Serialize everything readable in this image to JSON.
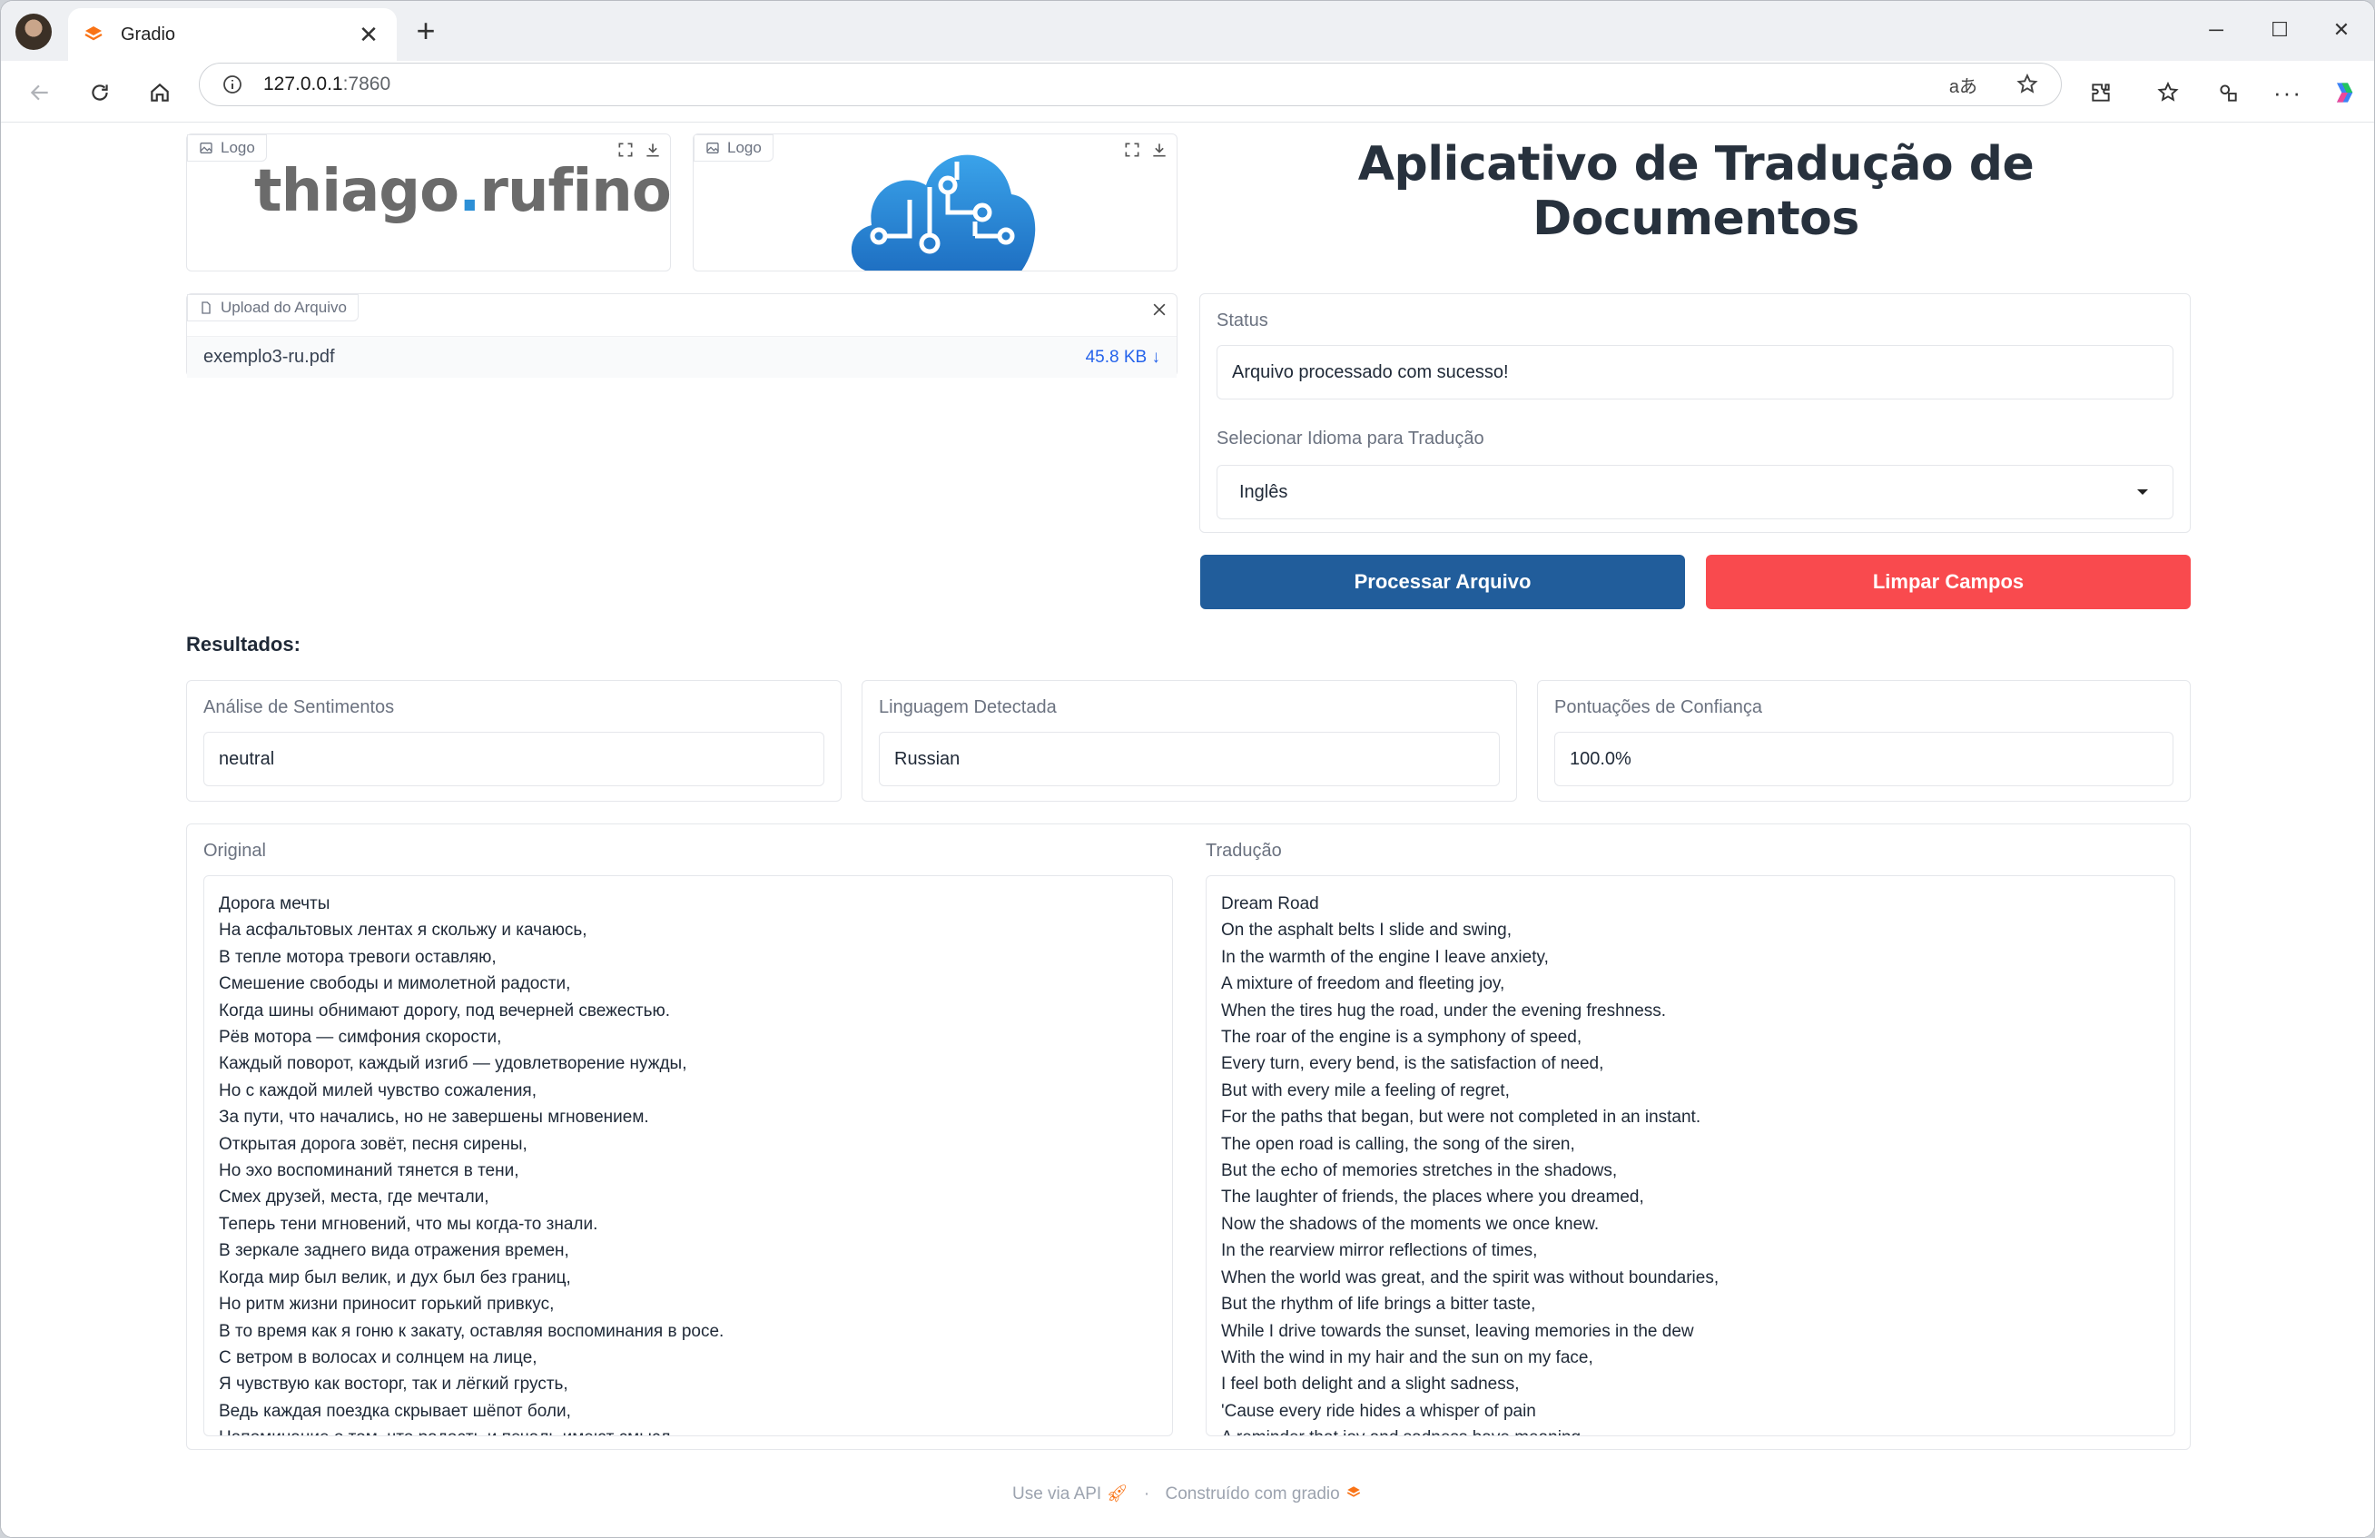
{
  "browser": {
    "tab_title": "Gradio",
    "url_host": "127.0.0.1",
    "url_port": ":7860"
  },
  "logos": {
    "logo1_label": "Logo",
    "logo1_text_a": "thiago",
    "logo1_text_dot": ".",
    "logo1_text_b": "rufino",
    "logo2_label": "Logo"
  },
  "header": {
    "title": "Aplicativo de Tradução de Documentos"
  },
  "upload": {
    "label": "Upload do Arquivo",
    "filename": "exemplo3-ru.pdf",
    "filesize": "45.8 KB ↓"
  },
  "status": {
    "label": "Status",
    "value": "Arquivo processado com sucesso!"
  },
  "language_select": {
    "label": "Selecionar Idioma para Tradução",
    "value": "Inglês"
  },
  "buttons": {
    "process": "Processar Arquivo",
    "clear": "Limpar Campos"
  },
  "results": {
    "title": "Resultados:",
    "sentiment_label": "Análise de Sentimentos",
    "sentiment_value": "neutral",
    "language_label": "Linguagem Detectada",
    "language_value": "Russian",
    "confidence_label": "Pontuações de Confiança",
    "confidence_value": "100.0%"
  },
  "original": {
    "label": "Original",
    "text": "Дорога мечты\nНа асфальтовых лентах я скольжу и качаюсь,\nВ тепле мотора тревоги оставляю,\nСмешение свободы и мимолетной радости,\nКогда шины обнимают дорогу, под вечерней свежестью.\nРёв мотора — симфония скорости,\nКаждый поворот, каждый изгиб — удовлетворение нужды,\nНо с каждой милей чувство сожаления,\nЗа пути, что начались, но не завершены мгновением.\nОткрытая дорога зовёт, песня сирены,\nНо эхо воспоминаний тянется в тени,\nСмех друзей, места, где мечтали,\nТеперь тени мгновений, что мы когда-то знали.\nВ зеркале заднего вида отражения времен,\nКогда мир был велик, и дух был без границ,\nНо ритм жизни приносит горький привкус,\nВ то время как я гоню к закату, оставляя воспоминания в росе.\nС ветром в волосах и солнцем на лице,\nЯ чувствую как восторг, так и лёгкий грусть,\nВедь каждая поездка скрывает шёпот боли,\nНапоминание о том, что радость и печаль имеют смысл."
  },
  "translation": {
    "label": "Tradução",
    "text": "Dream Road\nOn the asphalt belts I slide and swing,\nIn the warmth of the engine I leave anxiety,\nA mixture of freedom and fleeting joy,\nWhen the tires hug the road, under the evening freshness.\nThe roar of the engine is a symphony of speed,\nEvery turn, every bend, is the satisfaction of need,\nBut with every mile a feeling of regret,\nFor the paths that began, but were not completed in an instant.\nThe open road is calling, the song of the siren,\nBut the echo of memories stretches in the shadows,\nThe laughter of friends, the places where you dreamed,\nNow the shadows of the moments we once knew.\nIn the rearview mirror reflections of times,\nWhen the world was great, and the spirit was without boundaries,\nBut the rhythm of life brings a bitter taste,\nWhile I drive towards the sunset, leaving memories in the dew\nWith the wind in my hair and the sun on my face,\nI feel both delight and a slight sadness,\n'Cause every ride hides a whisper of pain\nA reminder that joy and sadness have meaning."
  },
  "footer": {
    "api": "Use via API",
    "sep": "·",
    "built": "Construído com gradio"
  },
  "colors": {
    "process_button": "#215d9b",
    "clear_button": "#f94a4e",
    "logo_blue": "#2c8fd6"
  }
}
